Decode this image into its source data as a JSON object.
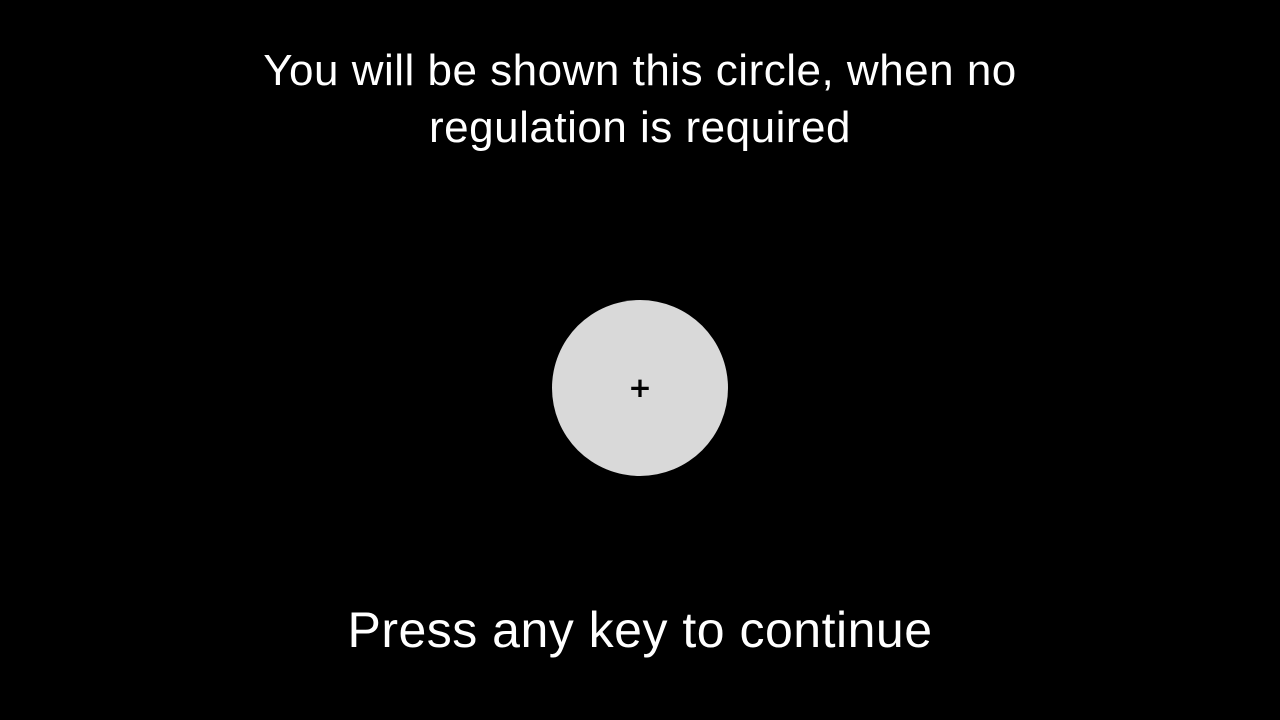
{
  "instruction": {
    "line1": "You will be shown this circle, when no",
    "line2": "regulation is required"
  },
  "stimulus": {
    "fixation_symbol": "+",
    "circle_color": "#d9d9d9"
  },
  "prompt": {
    "text": "Press any key to continue"
  },
  "colors": {
    "background": "#000000",
    "text": "#ffffff"
  }
}
